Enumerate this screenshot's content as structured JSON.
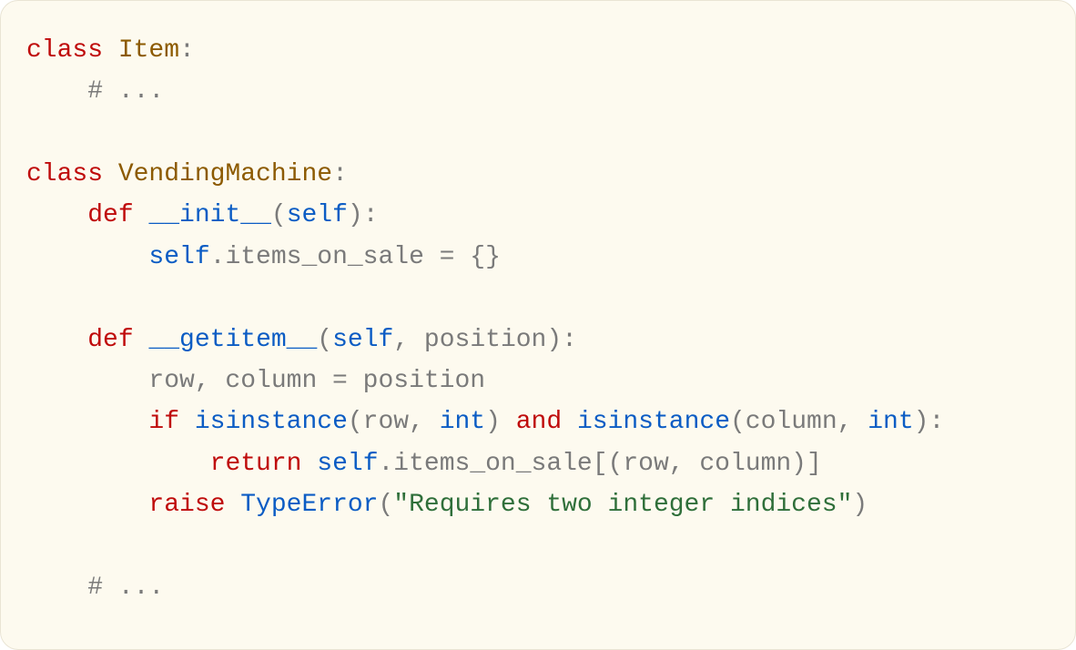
{
  "code": {
    "language": "python",
    "tokens": [
      {
        "t": "class",
        "c": "kw"
      },
      {
        "t": " "
      },
      {
        "t": "Item",
        "c": "cls"
      },
      {
        "t": ":",
        "c": "punc"
      },
      {
        "t": "\n"
      },
      {
        "t": "    "
      },
      {
        "t": "# ...",
        "c": "cmt"
      },
      {
        "t": "\n"
      },
      {
        "t": "\n"
      },
      {
        "t": "class",
        "c": "kw"
      },
      {
        "t": " "
      },
      {
        "t": "VendingMachine",
        "c": "cls"
      },
      {
        "t": ":",
        "c": "punc"
      },
      {
        "t": "\n"
      },
      {
        "t": "    "
      },
      {
        "t": "def",
        "c": "def"
      },
      {
        "t": " "
      },
      {
        "t": "__init__",
        "c": "fn"
      },
      {
        "t": "(",
        "c": "punc"
      },
      {
        "t": "self",
        "c": "self"
      },
      {
        "t": "):",
        "c": "punc"
      },
      {
        "t": "\n"
      },
      {
        "t": "        "
      },
      {
        "t": "self",
        "c": "self"
      },
      {
        "t": ".items_on_sale = {}",
        "c": "name"
      },
      {
        "t": "\n"
      },
      {
        "t": "\n"
      },
      {
        "t": "    "
      },
      {
        "t": "def",
        "c": "def"
      },
      {
        "t": " "
      },
      {
        "t": "__getitem__",
        "c": "fn"
      },
      {
        "t": "(",
        "c": "punc"
      },
      {
        "t": "self",
        "c": "self"
      },
      {
        "t": ", position):",
        "c": "name"
      },
      {
        "t": "\n"
      },
      {
        "t": "        "
      },
      {
        "t": "row, column = position",
        "c": "name"
      },
      {
        "t": "\n"
      },
      {
        "t": "        "
      },
      {
        "t": "if",
        "c": "kw"
      },
      {
        "t": " "
      },
      {
        "t": "isinstance",
        "c": "bltn"
      },
      {
        "t": "(row, ",
        "c": "name"
      },
      {
        "t": "int",
        "c": "bltn"
      },
      {
        "t": ") ",
        "c": "name"
      },
      {
        "t": "and",
        "c": "kw"
      },
      {
        "t": " "
      },
      {
        "t": "isinstance",
        "c": "bltn"
      },
      {
        "t": "(column, ",
        "c": "name"
      },
      {
        "t": "int",
        "c": "bltn"
      },
      {
        "t": "):",
        "c": "name"
      },
      {
        "t": "\n"
      },
      {
        "t": "            "
      },
      {
        "t": "return",
        "c": "kw"
      },
      {
        "t": " "
      },
      {
        "t": "self",
        "c": "self"
      },
      {
        "t": ".items_on_sale[(row, column)]",
        "c": "name"
      },
      {
        "t": "\n"
      },
      {
        "t": "        "
      },
      {
        "t": "raise",
        "c": "kw"
      },
      {
        "t": " "
      },
      {
        "t": "TypeError",
        "c": "bltn"
      },
      {
        "t": "(",
        "c": "name"
      },
      {
        "t": "\"Requires two integer indices\"",
        "c": "str"
      },
      {
        "t": ")",
        "c": "name"
      },
      {
        "t": "\n"
      },
      {
        "t": "\n"
      },
      {
        "t": "    "
      },
      {
        "t": "# ...",
        "c": "cmt"
      }
    ]
  },
  "colors": {
    "background": "#fdfaef",
    "border": "#e9e4d4",
    "keyword": "#bf0b0b",
    "classname": "#8c5a00",
    "function": "#0b5cc4",
    "self": "#0b5cc4",
    "builtin": "#0b5cc4",
    "string": "#2f6f3a",
    "comment": "#7a7a7a",
    "default": "#7a7a7a"
  }
}
